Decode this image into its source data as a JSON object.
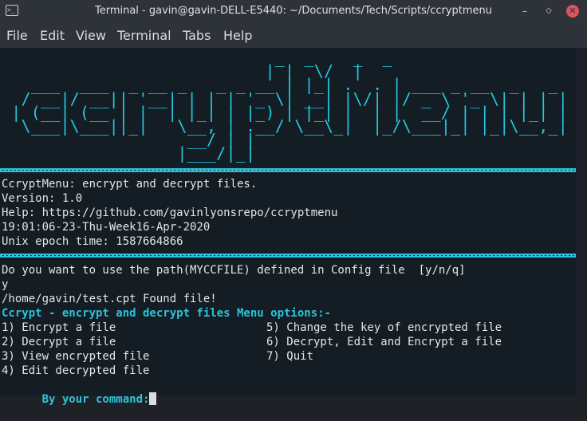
{
  "window": {
    "title": "Terminal - gavin@gavin-DELL-E5440: ~/Documents/Tech/Scripts/ccryptmenu",
    "app_icon_glyph": ">_",
    "min_glyph": "–",
    "max_glyph": "◇",
    "close_glyph": "✕"
  },
  "menu": [
    "File",
    "Edit",
    "View",
    "Terminal",
    "Tabs",
    "Help"
  ],
  "banner_text": "                            _  _    _  _ \n                           | |  \\/  |\n   ___  ___  _ __ _   _ _ __ | |_| .  . | ___ _ __  _   _ \n  / __|/ __|| '__| | | | '_ \\| __| |\\/| |/ _ \\ '_ \\| | | |\n | (__| (__ | |  | |_| | |_) | |_| |  | |  __/ | | | |_| |\n  \\___|\\___||_|   \\__, | .__/ \\__\\_|  |_/\\___|_| |_|\\__,_|\n                   __/ | |\n                  |___/|_|",
  "terminal": {
    "info_lines": [
      "CcryptMenu: encrypt and decrypt files.",
      "Version: 1.0",
      "Help: https://github.com/gavinlyonsrepo/ccryptmenu",
      "19:01:06-23-Thu-Week16-Apr-2020",
      "Unix epoch time: 1587664866"
    ],
    "question": "Do you want to use the path(MYCCFILE) defined in Config file  [y/n/q]",
    "answer": "y",
    "found": "/home/gavin/test.cpt Found file!",
    "menu_header": "Ccrypt - encrypt and decrypt files Menu options:-",
    "options_left": [
      "1) Encrypt a file",
      "2) Decrypt a file",
      "3) View encrypted file",
      "4) Edit decrypted file"
    ],
    "options_right": [
      "5) Change the key of encrypted file",
      "6) Decrypt, Edit and Encrypt a file",
      "7) Quit"
    ],
    "prompt": "By your command:"
  },
  "colors": {
    "accent": "#2bc4dc",
    "terminal_bg": "#141c24",
    "close_button": "#e0525a"
  }
}
